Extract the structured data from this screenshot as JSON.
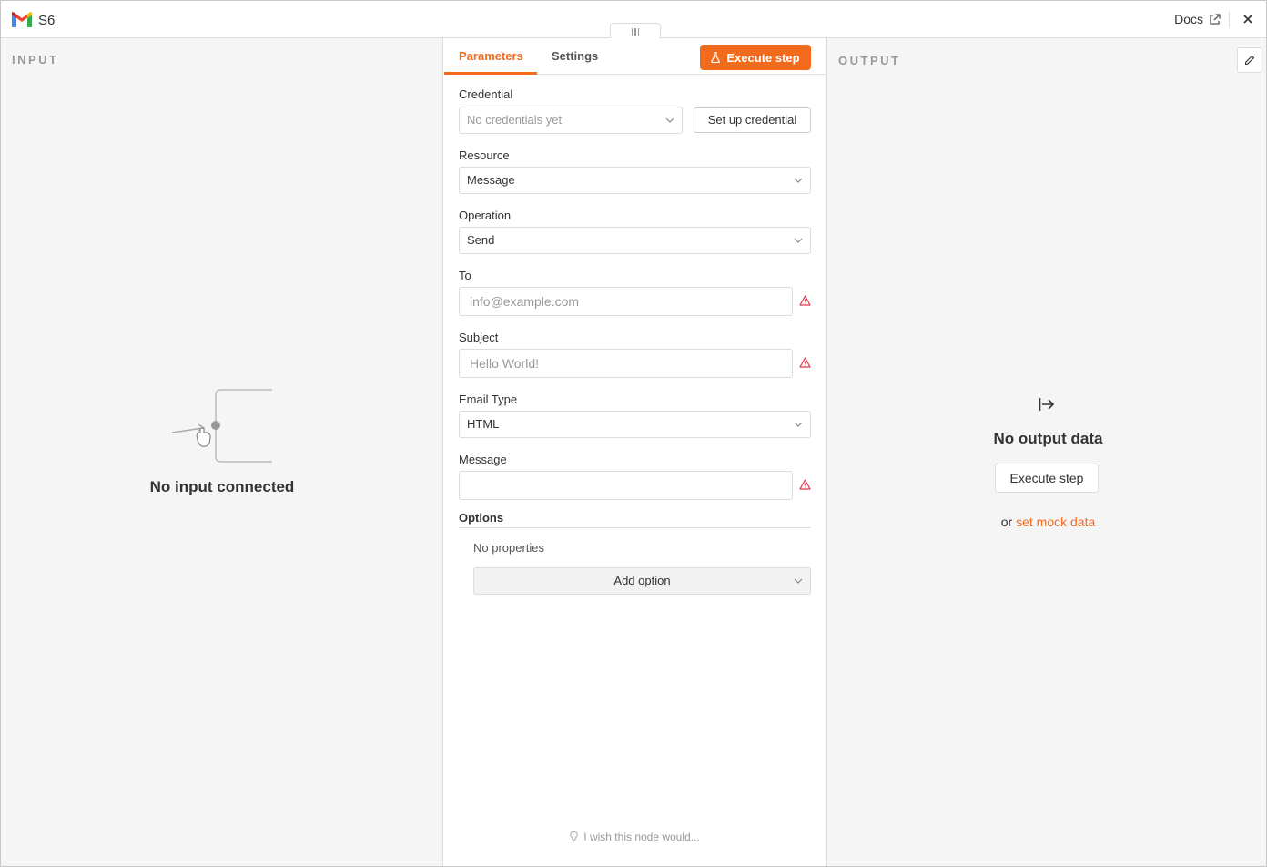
{
  "header": {
    "title": "S6",
    "docs_label": "Docs"
  },
  "input_panel": {
    "label": "INPUT",
    "empty_message": "No input connected"
  },
  "center": {
    "tabs": [
      {
        "label": "Parameters",
        "active": true
      },
      {
        "label": "Settings",
        "active": false
      }
    ],
    "execute_label": "Execute step",
    "credential": {
      "label": "Credential",
      "placeholder": "No credentials yet",
      "setup_label": "Set up credential"
    },
    "resource": {
      "label": "Resource",
      "value": "Message"
    },
    "operation": {
      "label": "Operation",
      "value": "Send"
    },
    "to": {
      "label": "To",
      "placeholder": "info@example.com"
    },
    "subject": {
      "label": "Subject",
      "placeholder": "Hello World!"
    },
    "email_type": {
      "label": "Email Type",
      "value": "HTML"
    },
    "message": {
      "label": "Message",
      "placeholder": ""
    },
    "options": {
      "label": "Options",
      "empty": "No properties",
      "add_label": "Add option"
    },
    "feedback": "I wish this node would..."
  },
  "output_panel": {
    "label": "OUTPUT",
    "empty_message": "No output data",
    "execute_label": "Execute step",
    "mock_prefix": "or ",
    "mock_link": "set mock data"
  },
  "colors": {
    "accent": "#f26b1d",
    "warning": "#e0364b"
  }
}
